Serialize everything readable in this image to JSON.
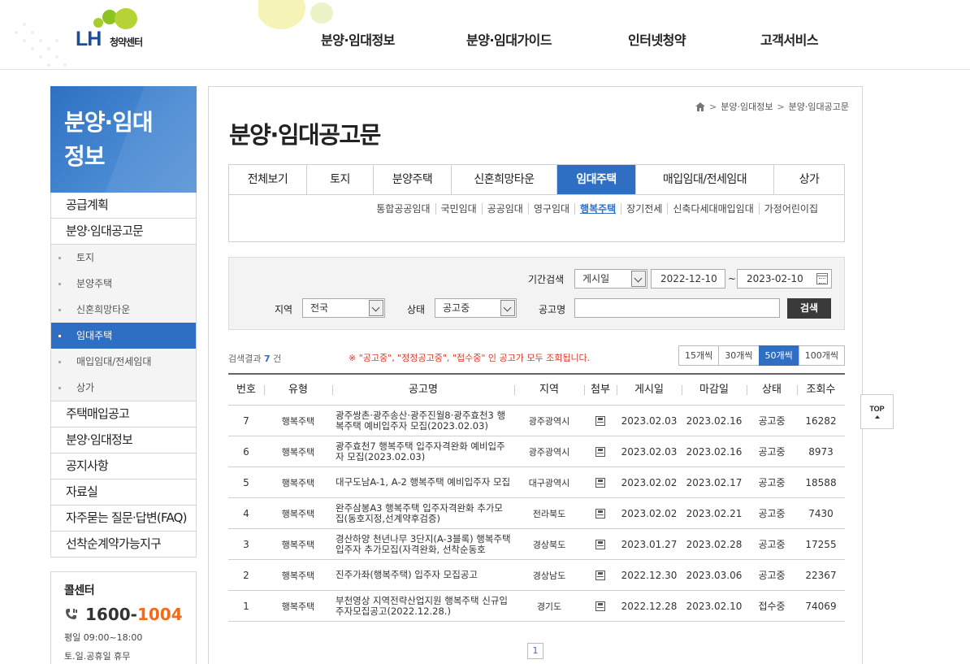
{
  "header": {
    "logo_text": "LH",
    "logo_sub": "청약센터",
    "gnb": [
      "분양·임대정보",
      "분양·임대가이드",
      "인터넷청약",
      "고객서비스"
    ]
  },
  "sidebar": {
    "title": "분양·임대\n정보",
    "items": [
      {
        "label": "공급계획"
      },
      {
        "label": "분양·임대공고문"
      }
    ],
    "sub_items": [
      "토지",
      "분양주택",
      "신혼희망타운",
      "임대주택",
      "매입임대/전세임대",
      "상가"
    ],
    "active_sub": "임대주택",
    "more_items": [
      "주택매입공고",
      "분양·임대정보",
      "공지사항",
      "자료실",
      "자주묻는 질문·답변(FAQ)",
      "선착순계약가능지구"
    ],
    "callcenter": {
      "title": "콜센터",
      "number_a": "1600-",
      "number_b": "1004",
      "hours": "평일 09:00~18:00",
      "holiday": "토.일.공휴일 휴무"
    }
  },
  "breadcrumb": [
    "분양·임대정보",
    "분양·임대공고문"
  ],
  "page_title": "분양·임대공고문",
  "tabs": [
    "전체보기",
    "토지",
    "분양주택",
    "신혼희망타운",
    "임대주택",
    "매입임대/전세임대",
    "상가"
  ],
  "active_tab": "임대주택",
  "subtabs": [
    "통합공공임대",
    "국민임대",
    "공공임대",
    "영구임대",
    "행복주택",
    "장기전세",
    "신축다세대매입임대",
    "가정어린이집"
  ],
  "active_subtab": "행복주택",
  "search": {
    "period_label": "기간검색",
    "period_type": "게시일",
    "date_from": "2022-12-10",
    "tilde": "~",
    "date_to": "2023-02-10",
    "region_label": "지역",
    "region_value": "전국",
    "status_label": "상태",
    "status_value": "공고중",
    "name_label": "공고명",
    "name_value": "",
    "button_label": "검색"
  },
  "results": {
    "prefix": "검색결과",
    "count": "7",
    "suffix": "건",
    "notice": "※ \"공고중\", \"정정공고중\", \"접수중\" 인 공고가 모두 조회됩니다.",
    "per_page": [
      "15개씩",
      "30개씩",
      "50개씩",
      "100개씩"
    ],
    "active_per_page": "50개씩"
  },
  "table": {
    "headers": [
      "번호",
      "유형",
      "공고명",
      "지역",
      "첨부",
      "게시일",
      "마감일",
      "상태",
      "조회수"
    ],
    "rows": [
      {
        "no": "7",
        "type": "행복주택",
        "title": "광주쌍촌·광주송산·광주진월8·광주효천3 행복주택 예비입주자 모집(2023.02.03)",
        "region": "광주광역시",
        "posted": "2023.02.03",
        "deadline": "2023.02.16",
        "status": "공고중",
        "views": "16282"
      },
      {
        "no": "6",
        "type": "행복주택",
        "title": "광주효천7 행복주택 입주자격완화 예비입주자 모집(2023.02.03)",
        "region": "광주광역시",
        "posted": "2023.02.03",
        "deadline": "2023.02.16",
        "status": "공고중",
        "views": "8973"
      },
      {
        "no": "5",
        "type": "행복주택",
        "title": "대구도남A-1, A-2 행복주택 예비입주자 모집",
        "region": "대구광역시",
        "posted": "2023.02.02",
        "deadline": "2023.02.17",
        "status": "공고중",
        "views": "18588"
      },
      {
        "no": "4",
        "type": "행복주택",
        "title": "완주삼봉A3 행복주택 입주자격완화 추가모집(동호지정,선계약후검증)",
        "region": "전라북도",
        "posted": "2023.02.02",
        "deadline": "2023.02.21",
        "status": "공고중",
        "views": "7430"
      },
      {
        "no": "3",
        "type": "행복주택",
        "title": "경산하양 천년나무 3단지(A-3블록) 행복주택 입주자 추가모집(자격완화, 선착순동호",
        "region": "경상북도",
        "posted": "2023.01.27",
        "deadline": "2023.02.28",
        "status": "공고중",
        "views": "17255"
      },
      {
        "no": "2",
        "type": "행복주택",
        "title": "진주가좌(행복주택) 입주자 모집공고",
        "region": "경상남도",
        "posted": "2022.12.30",
        "deadline": "2023.03.06",
        "status": "공고중",
        "views": "22367"
      },
      {
        "no": "1",
        "type": "행복주택",
        "title": "부천영상 지역전략산업지원 행복주택 신규입주자모집공고(2022.12.28.)",
        "region": "경기도",
        "posted": "2022.12.28",
        "deadline": "2023.02.10",
        "status": "접수중",
        "views": "74069"
      }
    ]
  },
  "pagination": {
    "current": "1"
  },
  "top_button": "TOP",
  "colors": {
    "primary": "#2f6fc3",
    "accent_orange": "#f26a1b",
    "notice_red": "#d83a2a"
  }
}
